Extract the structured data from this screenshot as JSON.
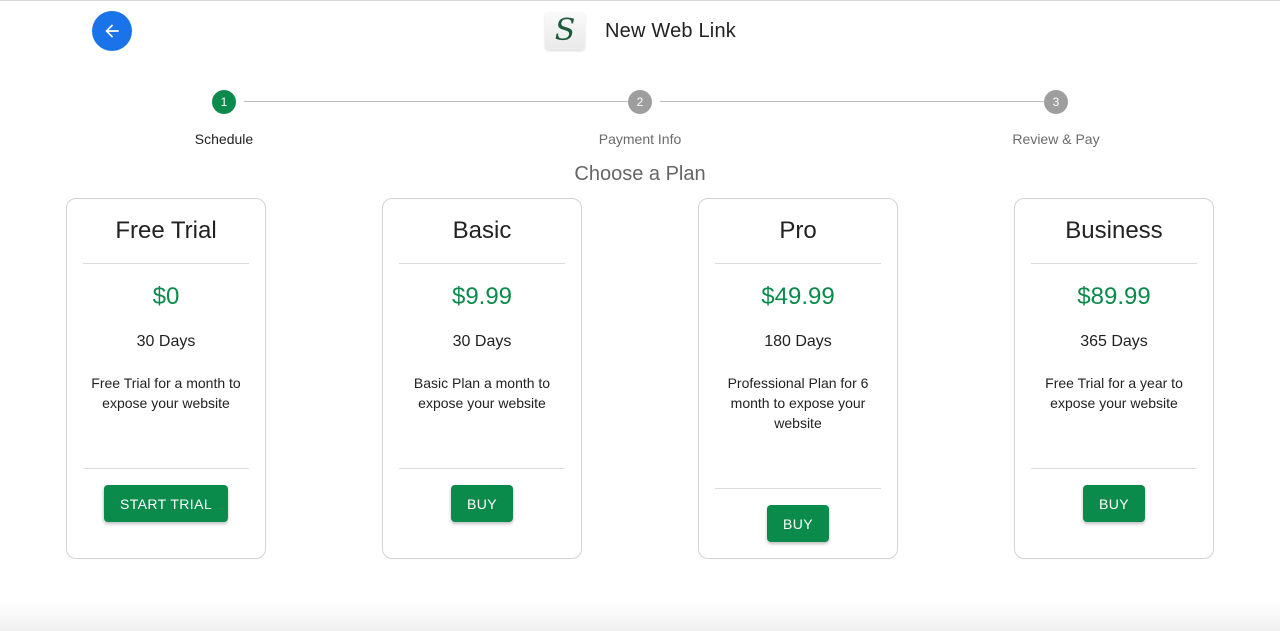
{
  "header": {
    "back_icon": "arrow-left-icon",
    "logo_text": "S",
    "title": "New Web Link"
  },
  "stepper": {
    "steps": [
      {
        "number": "1",
        "label": "Schedule",
        "active": true
      },
      {
        "number": "2",
        "label": "Payment Info",
        "active": false
      },
      {
        "number": "3",
        "label": "Review & Pay",
        "active": false
      }
    ]
  },
  "main": {
    "title": "Choose a Plan",
    "plans": [
      {
        "name": "Free Trial",
        "price": "$0",
        "duration": "30 Days",
        "description": "Free Trial for a month to expose your website",
        "button": "START TRIAL"
      },
      {
        "name": "Basic",
        "price": "$9.99",
        "duration": "30 Days",
        "description": "Basic Plan a month to expose your website",
        "button": "BUY"
      },
      {
        "name": "Pro",
        "price": "$49.99",
        "duration": "180 Days",
        "description": "Professional Plan for 6 month to expose your website",
        "button": "BUY"
      },
      {
        "name": "Business",
        "price": "$89.99",
        "duration": "365 Days",
        "description": "Free Trial for a year to expose your website",
        "button": "BUY"
      }
    ]
  },
  "colors": {
    "accent_green": "#0a8a4b",
    "back_button_blue": "#1a73e8",
    "inactive_step": "#9e9e9e"
  }
}
